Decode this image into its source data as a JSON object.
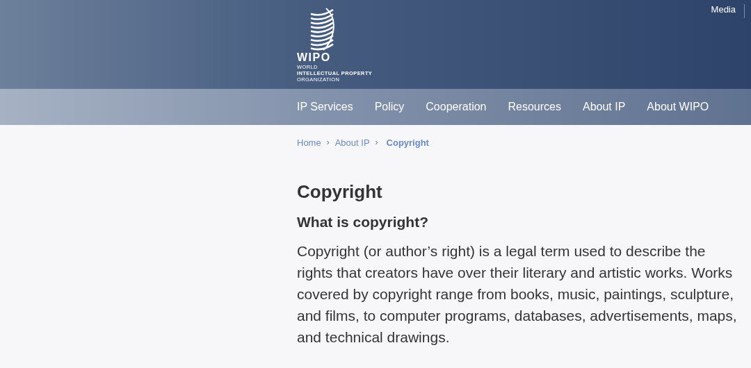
{
  "header": {
    "logo": {
      "acronym": "WIPO",
      "lines": [
        "WORLD",
        "INTELLECTUAL PROPERTY",
        "ORGANIZATION"
      ]
    },
    "top_links": [
      "Media"
    ]
  },
  "nav": {
    "items": [
      "IP Services",
      "Policy",
      "Cooperation",
      "Resources",
      "About IP",
      "About WIPO"
    ]
  },
  "breadcrumb": {
    "separator": "›",
    "items": [
      {
        "label": "Home",
        "current": false
      },
      {
        "label": "About IP",
        "current": false
      },
      {
        "label": "Copyright",
        "current": true
      }
    ]
  },
  "article": {
    "title": "Copyright",
    "subtitle": "What is copyright?",
    "paragraph": "Copyright (or author’s right) is a legal term used to describe the rights that creators have over their literary and artistic works. Works covered by copyright range from books, music, paintings, sculpture, and films, to computer programs, databases, advertisements, maps, and technical drawings."
  }
}
